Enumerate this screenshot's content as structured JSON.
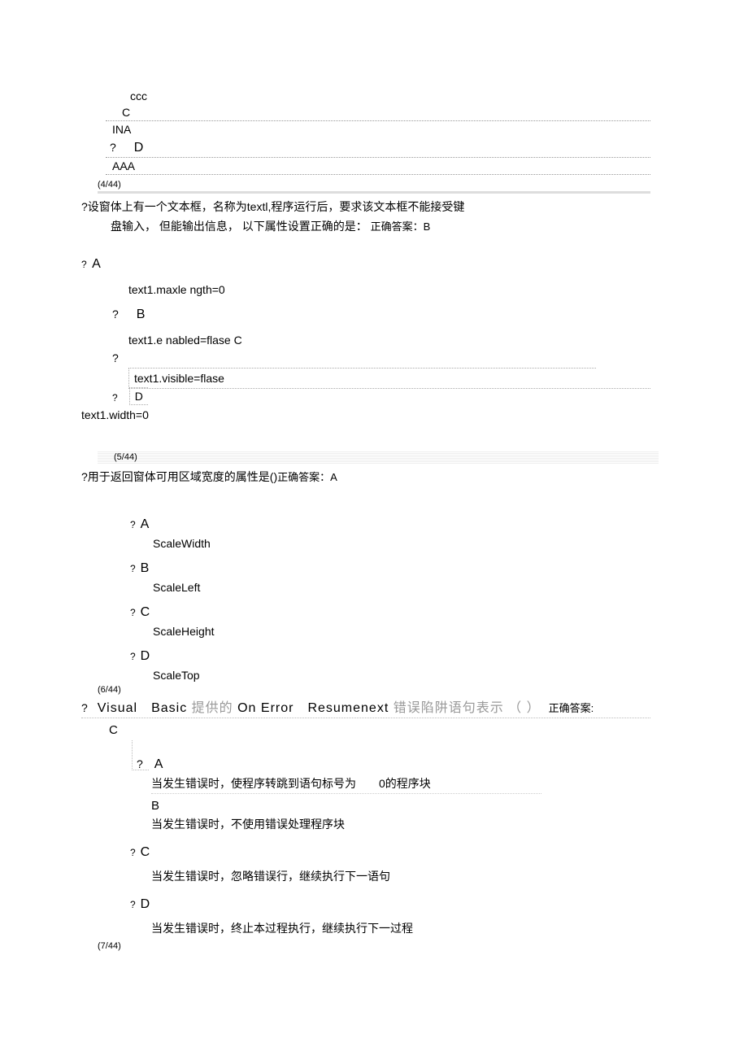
{
  "q3": {
    "ccc": "ccc",
    "c_label": "C",
    "c_text": "INA",
    "d_prefix": "?",
    "d_label": "D",
    "d_text": "AAA"
  },
  "q4": {
    "counter": "(4/44)",
    "question_line1": "?设窗体上有一个文本框，名称为textl,程序运行后，要求该文本框不能接受键",
    "question_line2_a": "盘输入， 但能输出信息， 以下属性设置正确的是： ",
    "question_line2_b": "正确答案：B",
    "a_prefix": "?",
    "a_label": "A",
    "a_text": "text1.maxle ngth=0",
    "b_prefix": "?",
    "b_label": "B",
    "b_text": "text1.e nabled=flase C",
    "c_prefix": "?",
    "c_text": "text1.visible=flase",
    "d_prefix": "?",
    "d_label": "D",
    "d_text": "text1.width=0"
  },
  "q5": {
    "counter": "(5/44)",
    "question": "?用于返回窗体可用区域宽度的属性是()",
    "answer": "正确答案：A",
    "a_prefix": "?",
    "a_label": "A",
    "a_text": "ScaleWidth",
    "b_prefix": "?",
    "b_label": "B",
    "b_text": "ScaleLeft",
    "c_prefix": "?",
    "c_label": "C",
    "c_text": "ScaleHeight",
    "d_prefix": "?",
    "d_label": "D",
    "d_text": "ScaleTop"
  },
  "q6": {
    "counter": "(6/44)",
    "q_prefix": "?",
    "q_black1": "Visual Basic ",
    "q_gray1": "提供的 ",
    "q_black2": "On Error Resumenext ",
    "q_gray2": "错误陷阱语句表示 （ ） ",
    "answer_tail": "正确答案:",
    "c_below": "C",
    "a_prefix": "?",
    "a_label": "A",
    "a_text": "当发生错误时，使程序转跳到语句标号为  0的程序块",
    "b_label": "B",
    "b_text": "当发生错误时，不使用错误处理程序块",
    "c_prefix": "?",
    "c_label": "C",
    "c_text": "当发生错误时，忽略错误行，继续执行下一语句",
    "d_prefix": "?",
    "d_label": "D",
    "d_text": "当发生错误时，终止本过程执行，继续执行下一过程"
  },
  "q7": {
    "counter": "(7/44)"
  }
}
